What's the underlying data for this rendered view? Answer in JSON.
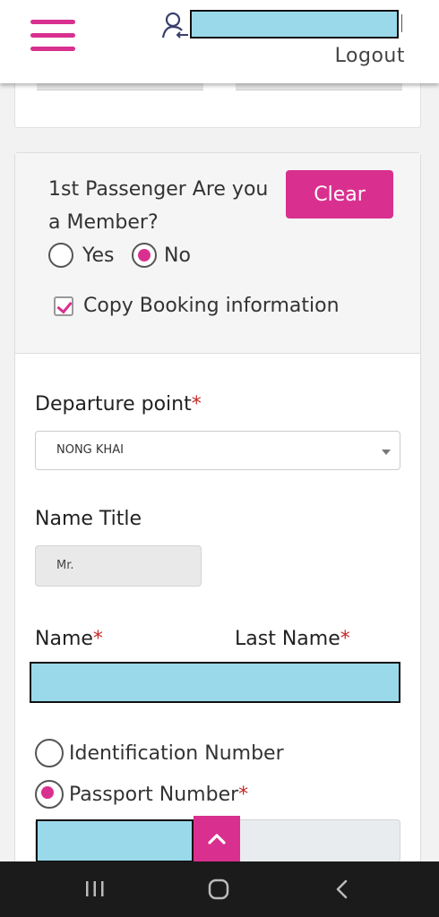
{
  "header": {
    "logout_label": "Logout",
    "username_redacted": ""
  },
  "passenger_card": {
    "member_question": "1st  Passenger Are you a Member?",
    "clear_label": "Clear",
    "member_options": [
      {
        "label": "Yes",
        "selected": false
      },
      {
        "label": "No",
        "selected": true
      }
    ],
    "copy_booking_label": "Copy Booking information",
    "copy_booking_checked": true
  },
  "form": {
    "departure_label": "Departure point",
    "departure_value": "NONG KHAI",
    "name_title_label": "Name Title",
    "name_title_value": "Mr.",
    "name_label": "Name",
    "last_name_label": "Last Name",
    "id_type_options": [
      {
        "label": "Identification Number",
        "selected": false
      },
      {
        "label": "Passport Number",
        "selected": true
      }
    ],
    "required_mark": "*"
  },
  "colors": {
    "accent": "#d9308f",
    "redaction": "#9ad9ea",
    "required": "#c62828"
  },
  "icons": {
    "menu": "hamburger-icon",
    "user": "user-icon",
    "scroll_top": "chevron-up-icon"
  }
}
